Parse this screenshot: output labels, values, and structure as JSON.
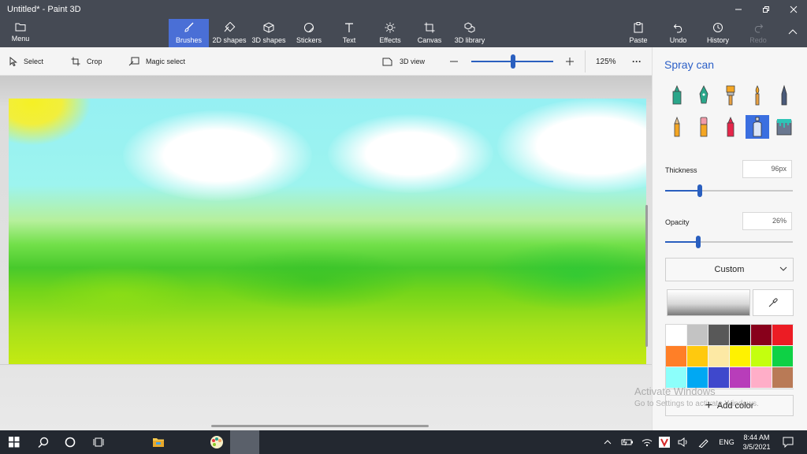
{
  "window": {
    "title": "Untitled* - Paint 3D",
    "controls": [
      "minimize-icon",
      "restore-icon",
      "close-icon"
    ]
  },
  "ribbon": {
    "menu": {
      "label": "Menu",
      "icon": "folder-icon"
    },
    "tabs": [
      {
        "label": "Brushes",
        "icon": "brush-icon",
        "active": true
      },
      {
        "label": "2D shapes",
        "icon": "2d-shapes-icon"
      },
      {
        "label": "3D shapes",
        "icon": "3d-cube-icon"
      },
      {
        "label": "Stickers",
        "icon": "sticker-icon"
      },
      {
        "label": "Text",
        "icon": "text-icon"
      },
      {
        "label": "Effects",
        "icon": "sun-effects-icon"
      },
      {
        "label": "Canvas",
        "icon": "canvas-crop-icon"
      },
      {
        "label": "3D library",
        "icon": "3d-library-icon"
      }
    ],
    "actions": [
      {
        "label": "Paste",
        "icon": "paste-icon",
        "enabled": true
      },
      {
        "label": "Undo",
        "icon": "undo-icon",
        "enabled": true
      },
      {
        "label": "History",
        "icon": "history-icon",
        "enabled": true
      },
      {
        "label": "Redo",
        "icon": "redo-icon",
        "enabled": false
      }
    ]
  },
  "toolbar": {
    "select_label": "Select",
    "crop_label": "Crop",
    "magic_select_label": "Magic select",
    "view3d_label": "3D view",
    "zoom_value": "125%",
    "zoom_level_fraction": 0.5,
    "more_label": "···"
  },
  "panel": {
    "title": "Spray can",
    "brushes": [
      {
        "name": "marker",
        "selected": false
      },
      {
        "name": "calligraphy-pen",
        "selected": false
      },
      {
        "name": "oil-brush",
        "selected": false
      },
      {
        "name": "watercolor",
        "selected": false
      },
      {
        "name": "pixel-pen",
        "selected": false
      },
      {
        "name": "pencil",
        "selected": false
      },
      {
        "name": "eraser",
        "selected": false
      },
      {
        "name": "crayon",
        "selected": false
      },
      {
        "name": "spray-can",
        "selected": true
      },
      {
        "name": "fill",
        "selected": false
      }
    ],
    "thickness_label": "Thickness",
    "thickness_value": "96px",
    "thickness_fraction": 0.27,
    "opacity_label": "Opacity",
    "opacity_value": "26%",
    "opacity_fraction": 0.26,
    "color_mode": "Custom",
    "palette": [
      "#ffffff",
      "#c3c3c3",
      "#585858",
      "#000000",
      "#88001b",
      "#ec1c24",
      "#ff7f27",
      "#ffc90e",
      "#fde9a4",
      "#fff200",
      "#c4ff0e",
      "#0ed145",
      "#8cfffb",
      "#00a8f3",
      "#3f48cc",
      "#b83dba",
      "#ffaec8",
      "#b97a56"
    ],
    "add_color_label": "Add color"
  },
  "watermark": {
    "line1": "Activate Windows",
    "line2": "Go to Settings to activate Windows."
  },
  "taskbar": {
    "language": "ENG",
    "time": "8:44 AM",
    "date": "3/5/2021",
    "icons": [
      "windows-start-icon",
      "search-icon",
      "cortana-icon",
      "task-view-icon",
      "file-explorer-icon",
      "paint3d-app-icon"
    ],
    "tray_icons": [
      "chevron-up-icon",
      "battery-icon",
      "wifi-icon",
      "antivirus-icon",
      "volume-icon",
      "pen-icon",
      "notification-icon"
    ]
  }
}
